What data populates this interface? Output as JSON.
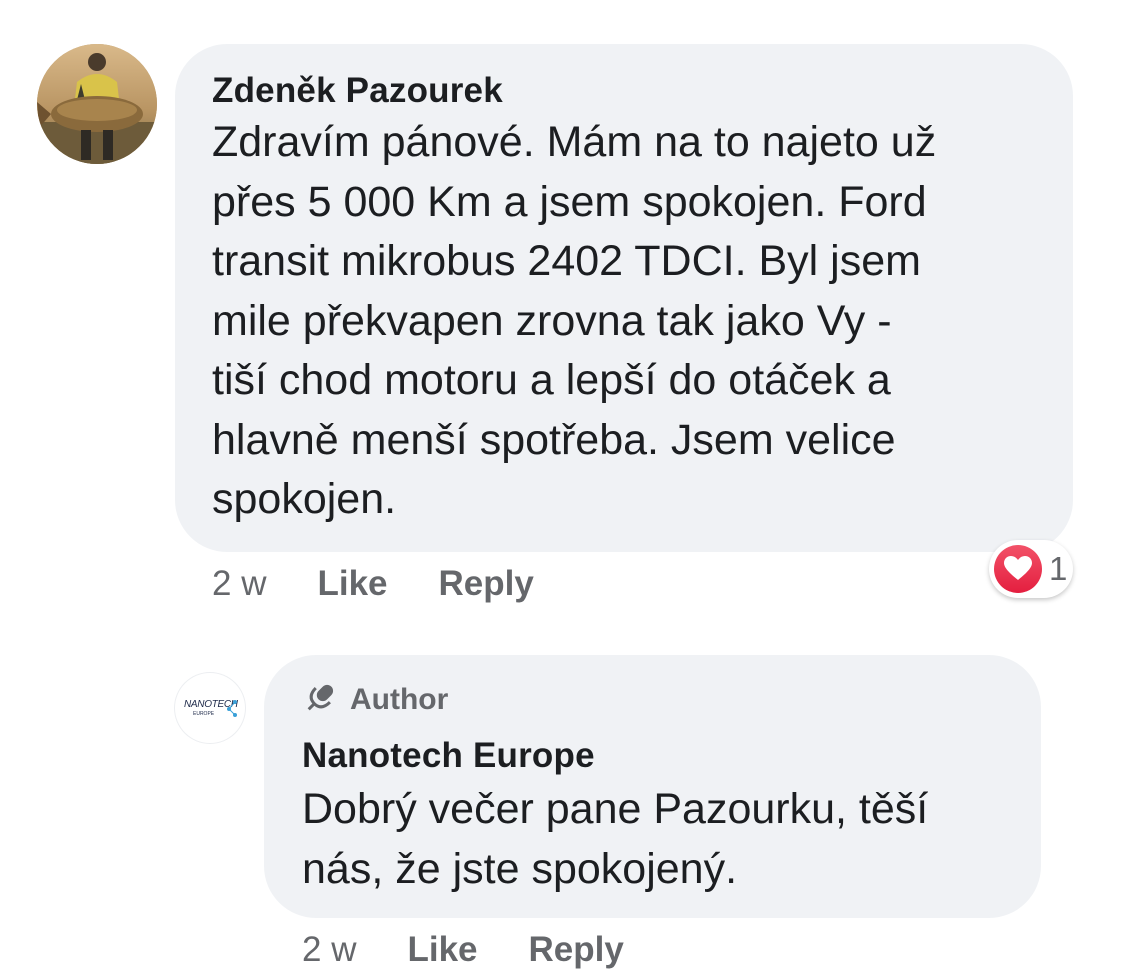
{
  "comments": [
    {
      "author": "Zdeněk Pazourek",
      "text": "Zdravím pánové. Mám  na to najeto už\npřes 5 000 Km a jsem spokojen. Ford\ntransit mikrobus 2402 TDCI. Byl jsem\nmile překvapen zrovna tak jako Vy -\ntiší chod motoru a lepší do otáček a\nhlavně menší spotřeba. Jsem velice\nspokojen.",
      "time": "2 w",
      "like_label": "Like",
      "reply_label": "Reply",
      "reactions": {
        "icon": "heart-icon",
        "count": "1",
        "color": "#e41e3f"
      }
    },
    {
      "badge": {
        "icon": "microphone-icon",
        "label": "Author"
      },
      "avatar_logo": {
        "text": "NANOTECH",
        "subtext": "EUROPE"
      },
      "author": "Nanotech Europe",
      "text": "Dobrý večer pane Pazourku, těší\nnás, že jste spokojený.",
      "time": "2 w",
      "like_label": "Like",
      "reply_label": "Reply"
    }
  ],
  "colors": {
    "bubble_bg": "#f0f2f5",
    "text_primary": "#1c1e21",
    "text_secondary": "#65676b",
    "reaction_red": "#e41e3f"
  }
}
